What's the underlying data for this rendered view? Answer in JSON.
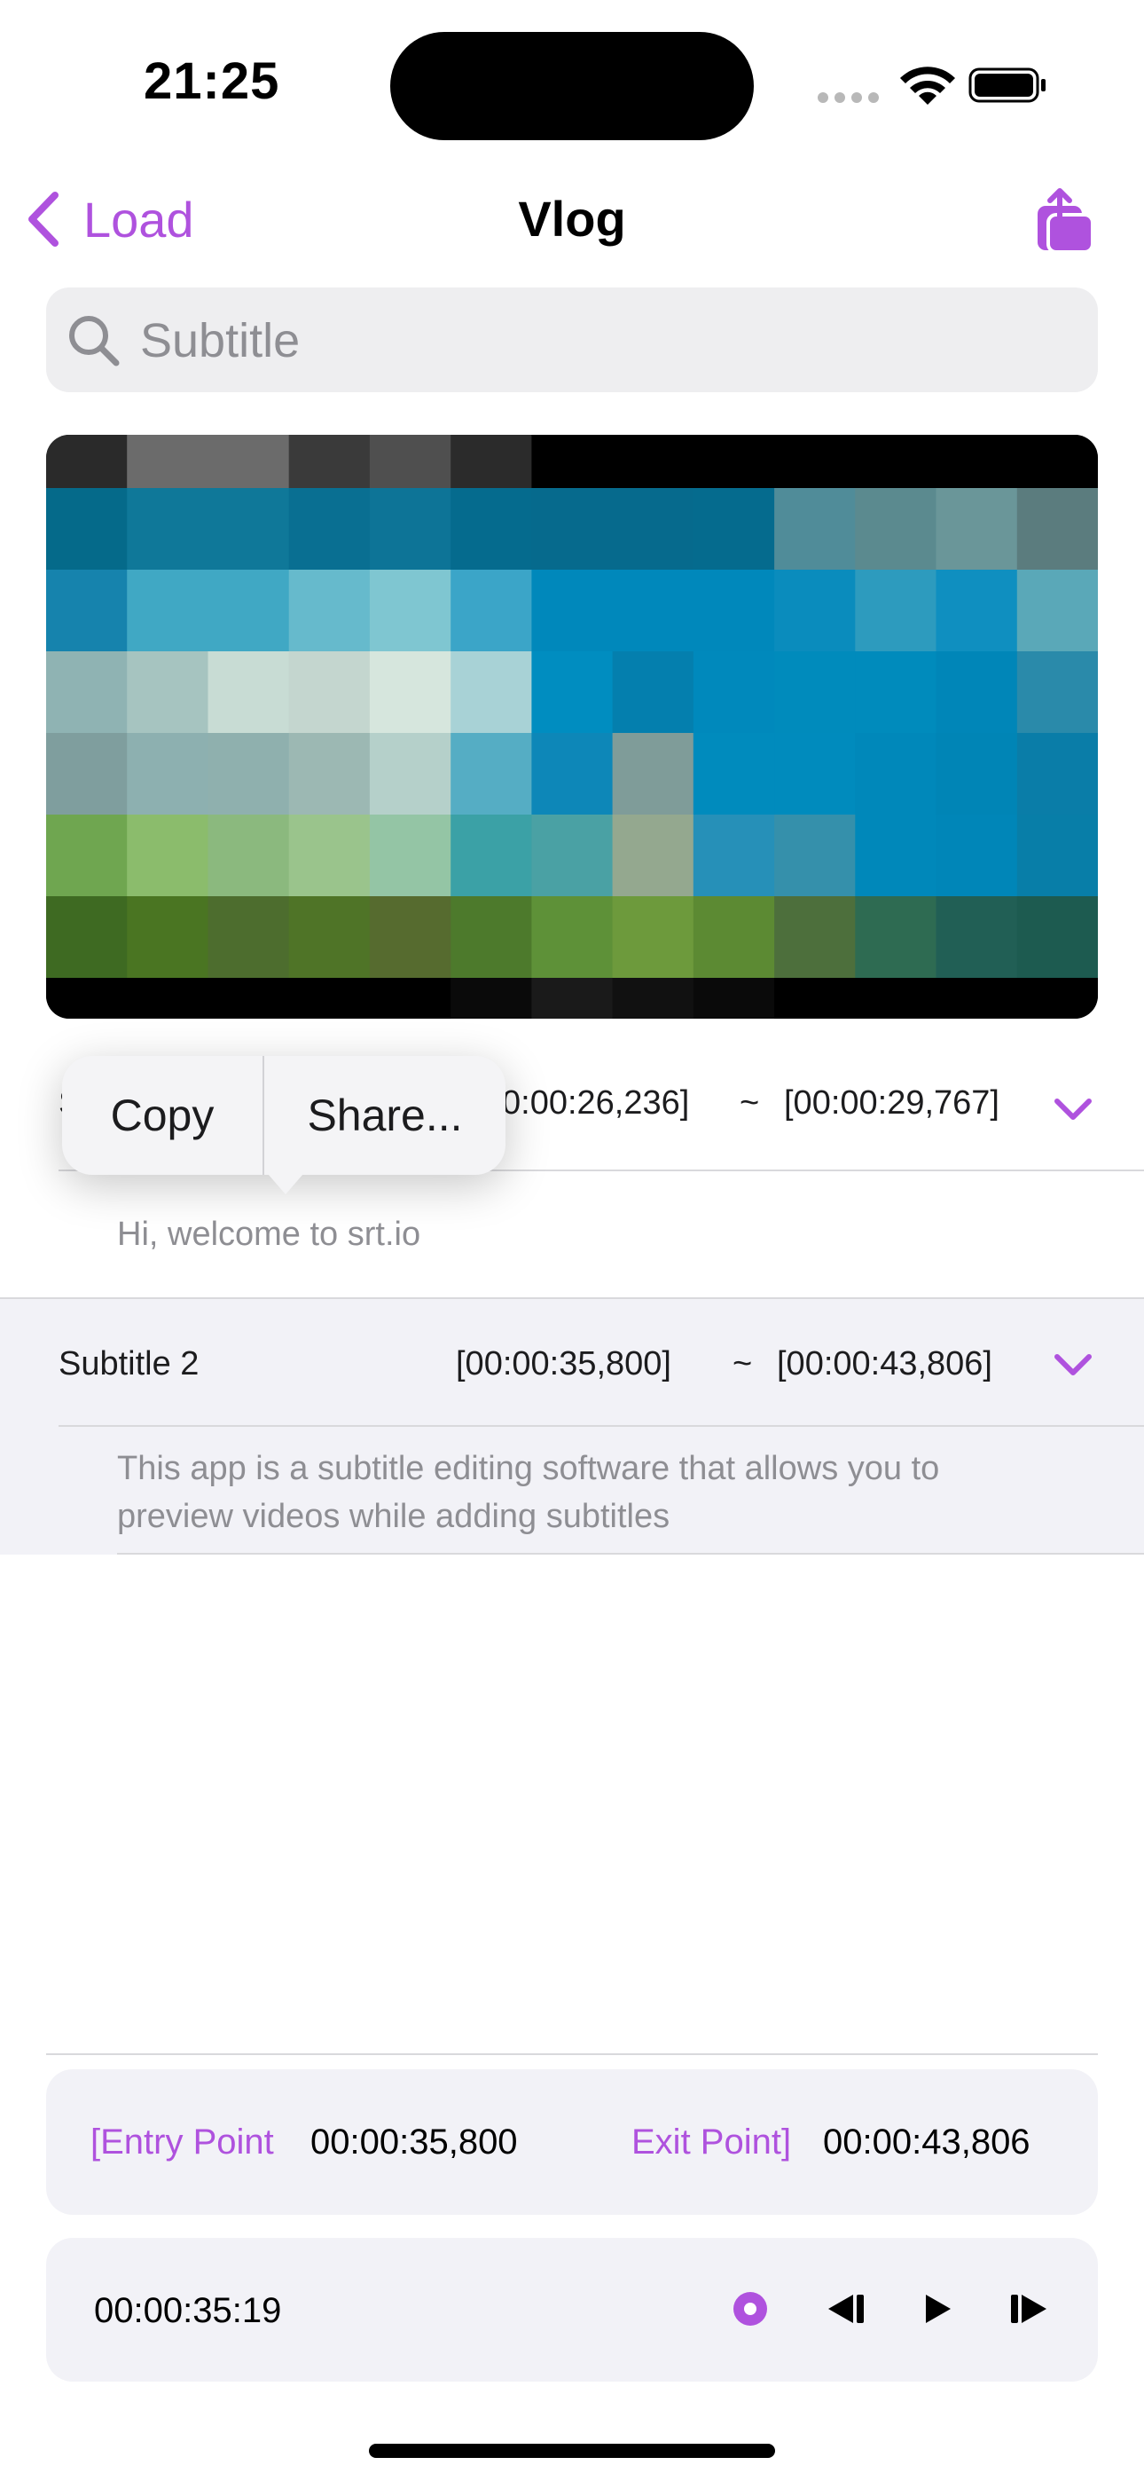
{
  "status_bar": {
    "time": "21:25"
  },
  "nav": {
    "back_label": "Load",
    "title": "Vlog"
  },
  "search": {
    "placeholder": "Subtitle"
  },
  "context_menu": {
    "copy_label": "Copy",
    "share_label": "Share..."
  },
  "subtitles": [
    {
      "label": "Subtitle 1",
      "visible_label_fragment": "S",
      "start": "[00:00:26,236]",
      "start_visible": "0:00:26,236]",
      "separator": "~",
      "end": "[00:00:29,767]",
      "text": "Hi, welcome to srt.io"
    },
    {
      "label": "Subtitle 2",
      "start": "[00:00:35,800]",
      "separator": "~",
      "end": "[00:00:43,806]",
      "text_line1": "This app is a subtitle editing software that allows you to",
      "text_line2": "preview videos while adding subtitles"
    }
  ],
  "entry_exit": {
    "entry_label": "[Entry Point",
    "entry_value": "00:00:35,800",
    "exit_label": "Exit Point]",
    "exit_value": "00:00:43,806"
  },
  "player": {
    "current_time": "00:00:35:19"
  },
  "colors": {
    "accent": "#af52de",
    "panel_bg": "#f2f2f7",
    "secondary_text": "#8e8e93"
  },
  "icons": [
    "chevron-left-icon",
    "share-icon",
    "search-icon",
    "chevron-down-icon",
    "record-icon",
    "step-back-icon",
    "play-icon",
    "step-forward-icon",
    "wifi-icon",
    "battery-icon"
  ]
}
